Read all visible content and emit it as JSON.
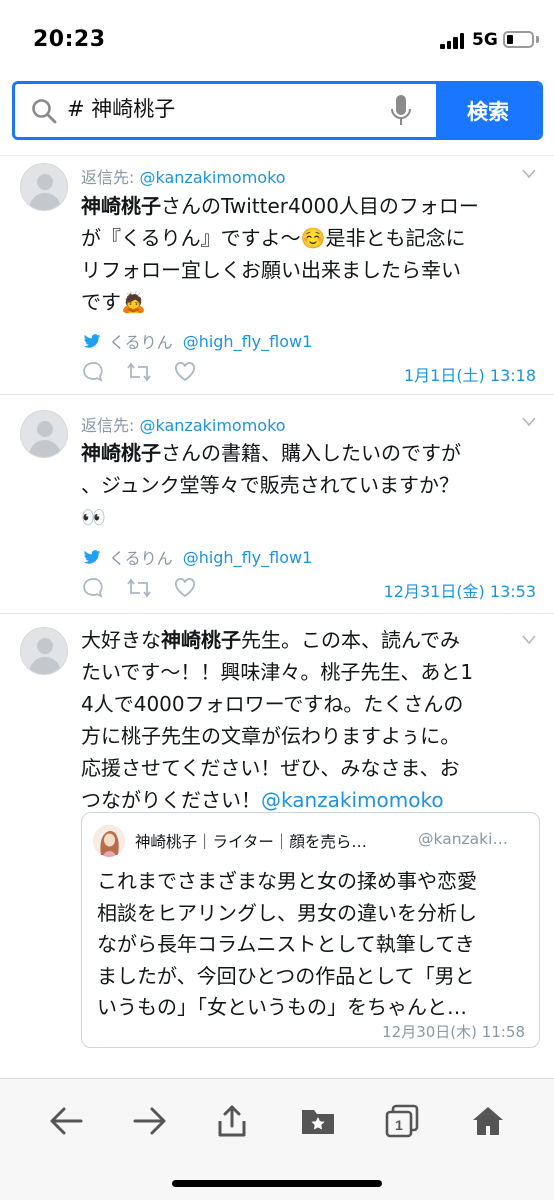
{
  "status_bar": {
    "time": "20:23",
    "network": "5G"
  },
  "search": {
    "query": "# 神崎桃子",
    "button_label": "検索"
  },
  "tweets": [
    {
      "reply_to_label": "返信先: ",
      "reply_to_handle": "@kanzakimomoko",
      "text_bold": "神崎桃子",
      "text_line1_rest": "さんのTwitter4000人目のフォロー",
      "text_line2": "が『くるりん』ですよ〜☺️是非とも記念に",
      "text_line3": "リフォロー宜しくお願い出来ましたら幸い",
      "text_line4": "です🙇",
      "via_name": "くるりん",
      "via_handle": "@high_fly_flow1",
      "timestamp": "1月1日(土) 13:18"
    },
    {
      "reply_to_label": "返信先: ",
      "reply_to_handle": "@kanzakimomoko",
      "text_bold": "神崎桃子",
      "text_line1_rest": "さんの書籍、購入したいのですが",
      "text_line2": "、ジュンク堂等々で販売されていますか？",
      "text_line3": "👀",
      "via_name": "くるりん",
      "via_handle": "@high_fly_flow1",
      "timestamp": "12月31日(金) 13:53"
    },
    {
      "text_pre": "大好きな",
      "text_bold": "神崎桃子",
      "text_line1_rest": "先生。この本、読んでみ",
      "text_line2": "たいです〜！！興味津々。桃子先生、あと1",
      "text_line3": "4人で4000フォロワーですね。たくさんの",
      "text_line4": "方に桃子先生の文章が伝わりますよぅに。",
      "text_line5": "応援させてください！ぜひ、みなさま、お",
      "text_line6_pre": "つながりください！",
      "text_line6_link": "@kanzakimomoko",
      "quote": {
        "name": "神崎桃子｜ライター｜顔を売ら…",
        "handle": "@kanzaki…",
        "line1": "これまでさまざまな男と女の揉め事や恋愛",
        "line2": "相談をヒアリングし、男女の違いを分析し",
        "line3": "ながら長年コラムニストとして執筆してき",
        "line4": "ましたが、今回ひとつの作品として「男と",
        "line5": "いうもの」「女というもの」をちゃんと…",
        "timestamp": "12月30日(木) 11:58"
      }
    }
  ],
  "toolbar": {
    "tab_count": "1"
  },
  "colors": {
    "accent": "#1a75ff",
    "link": "#1b95e0",
    "muted": "#8899a6"
  }
}
